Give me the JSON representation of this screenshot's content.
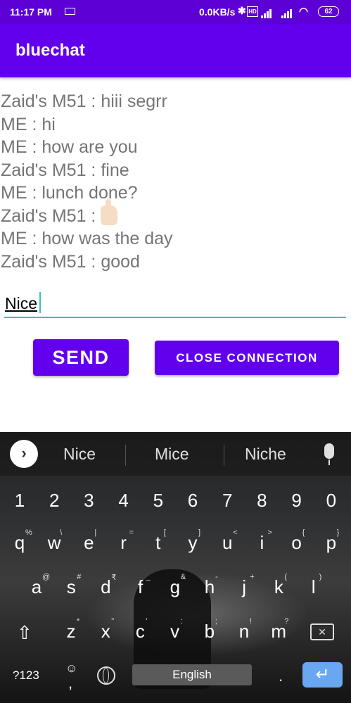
{
  "status_bar": {
    "time": "11:17 PM",
    "net_speed": "0.0KB/s",
    "hd_badge": "HD",
    "battery": "62"
  },
  "app_bar": {
    "title": "bluechat"
  },
  "messages": [
    "Zaid's M51 : hiii segrr",
    "ME : hi",
    "ME : how are you",
    "Zaid's M51 : fine",
    "ME : lunch done?",
    "Zaid's M51 :",
    "ME : how was the day",
    "Zaid's M51 : good"
  ],
  "input": {
    "value": "Nice"
  },
  "buttons": {
    "send": "SEND",
    "close": "CLOSE CONNECTION"
  },
  "keyboard": {
    "suggestions": [
      "Nice",
      "Mice",
      "Niche"
    ],
    "number_row": [
      "1",
      "2",
      "3",
      "4",
      "5",
      "6",
      "7",
      "8",
      "9",
      "0"
    ],
    "row1": [
      "q",
      "w",
      "e",
      "r",
      "t",
      "y",
      "u",
      "i",
      "o",
      "p"
    ],
    "row1_hints": [
      "%",
      "\\",
      "|",
      "=",
      "[",
      "]",
      "<",
      ">",
      "{",
      "}"
    ],
    "row2": [
      "a",
      "s",
      "d",
      "f",
      "g",
      "h",
      "j",
      "k",
      "l"
    ],
    "row2_hints": [
      "@",
      "#",
      "₹",
      "_",
      "&",
      "-",
      "+",
      "(",
      ")"
    ],
    "row3": [
      "z",
      "x",
      "c",
      "v",
      "b",
      "n",
      "m"
    ],
    "row3_hints": [
      "*",
      "\"",
      "'",
      ":",
      ";",
      "!",
      "?"
    ],
    "symbols_key": "?123",
    "comma": ",",
    "space_label": "English",
    "period": "."
  },
  "colors": {
    "primary": "#6200ee",
    "status": "#5d00d6",
    "accent": "#2bc9b4",
    "enter": "#6aa7f2"
  }
}
